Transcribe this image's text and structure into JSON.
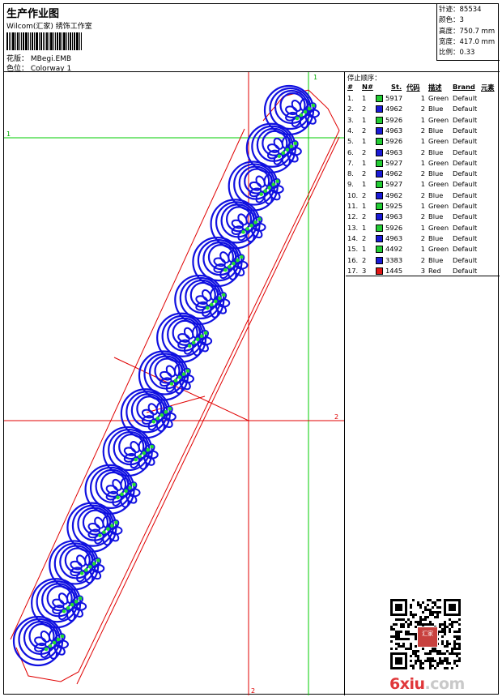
{
  "header": {
    "title": "生产作业图",
    "company": "Wilcom(汇家) 绣饰工作室",
    "design_label": "花版：",
    "design_value": "MBegi.EMB",
    "colorway_label": "色位：",
    "colorway_value": "Colorway 1"
  },
  "stats": [
    {
      "label": "针迹：",
      "value": "85534"
    },
    {
      "label": "颜色：",
      "value": "3"
    },
    {
      "label": "高度：",
      "value": "750.7 mm"
    },
    {
      "label": "宽度：",
      "value": "417.0 mm"
    },
    {
      "label": "比例：",
      "value": "0.33"
    }
  ],
  "stop_sequence": {
    "title": "停止顺序：",
    "columns": [
      "#",
      "N#",
      "St.",
      "代码",
      "描述",
      "Brand",
      "元素"
    ],
    "rows": [
      {
        "idx": "1.",
        "n": "1",
        "st": "5917",
        "code": "1",
        "desc": "Green",
        "brand": "Default",
        "color": "#22cc33"
      },
      {
        "idx": "2.",
        "n": "2",
        "st": "4962",
        "code": "2",
        "desc": "Blue",
        "brand": "Default",
        "color": "#1a1ad6"
      },
      {
        "idx": "3.",
        "n": "1",
        "st": "5926",
        "code": "1",
        "desc": "Green",
        "brand": "Default",
        "color": "#22cc33"
      },
      {
        "idx": "4.",
        "n": "2",
        "st": "4963",
        "code": "2",
        "desc": "Blue",
        "brand": "Default",
        "color": "#1a1ad6"
      },
      {
        "idx": "5.",
        "n": "1",
        "st": "5926",
        "code": "1",
        "desc": "Green",
        "brand": "Default",
        "color": "#22cc33"
      },
      {
        "idx": "6.",
        "n": "2",
        "st": "4963",
        "code": "2",
        "desc": "Blue",
        "brand": "Default",
        "color": "#1a1ad6"
      },
      {
        "idx": "7.",
        "n": "1",
        "st": "5927",
        "code": "1",
        "desc": "Green",
        "brand": "Default",
        "color": "#22cc33"
      },
      {
        "idx": "8.",
        "n": "2",
        "st": "4962",
        "code": "2",
        "desc": "Blue",
        "brand": "Default",
        "color": "#1a1ad6"
      },
      {
        "idx": "9.",
        "n": "1",
        "st": "5927",
        "code": "1",
        "desc": "Green",
        "brand": "Default",
        "color": "#22cc33"
      },
      {
        "idx": "10.",
        "n": "2",
        "st": "4962",
        "code": "2",
        "desc": "Blue",
        "brand": "Default",
        "color": "#1a1ad6"
      },
      {
        "idx": "11.",
        "n": "1",
        "st": "5925",
        "code": "1",
        "desc": "Green",
        "brand": "Default",
        "color": "#22cc33"
      },
      {
        "idx": "12.",
        "n": "2",
        "st": "4963",
        "code": "2",
        "desc": "Blue",
        "brand": "Default",
        "color": "#1a1ad6"
      },
      {
        "idx": "13.",
        "n": "1",
        "st": "5926",
        "code": "1",
        "desc": "Green",
        "brand": "Default",
        "color": "#22cc33"
      },
      {
        "idx": "14.",
        "n": "2",
        "st": "4963",
        "code": "2",
        "desc": "Blue",
        "brand": "Default",
        "color": "#1a1ad6"
      },
      {
        "idx": "15.",
        "n": "1",
        "st": "4492",
        "code": "1",
        "desc": "Green",
        "brand": "Default",
        "color": "#22cc33"
      },
      {
        "idx": "16.",
        "n": "2",
        "st": "3383",
        "code": "2",
        "desc": "Blue",
        "brand": "Default",
        "color": "#1a1ad6"
      },
      {
        "idx": "17.",
        "n": "3",
        "st": "1445",
        "code": "3",
        "desc": "Red",
        "brand": "Default",
        "color": "#e01515"
      }
    ]
  },
  "guides": {
    "marker_1": "1",
    "marker_2": "2",
    "red_color": "#e00000",
    "green_color": "#00cc00"
  },
  "colors": {
    "stitch_blue": "#1010e0",
    "stitch_green": "#22dd33",
    "outline_red": "#e00000"
  },
  "watermark": {
    "part_a": "6xiu",
    "part_b": ".com"
  },
  "qr_stamp_text": "汇家"
}
